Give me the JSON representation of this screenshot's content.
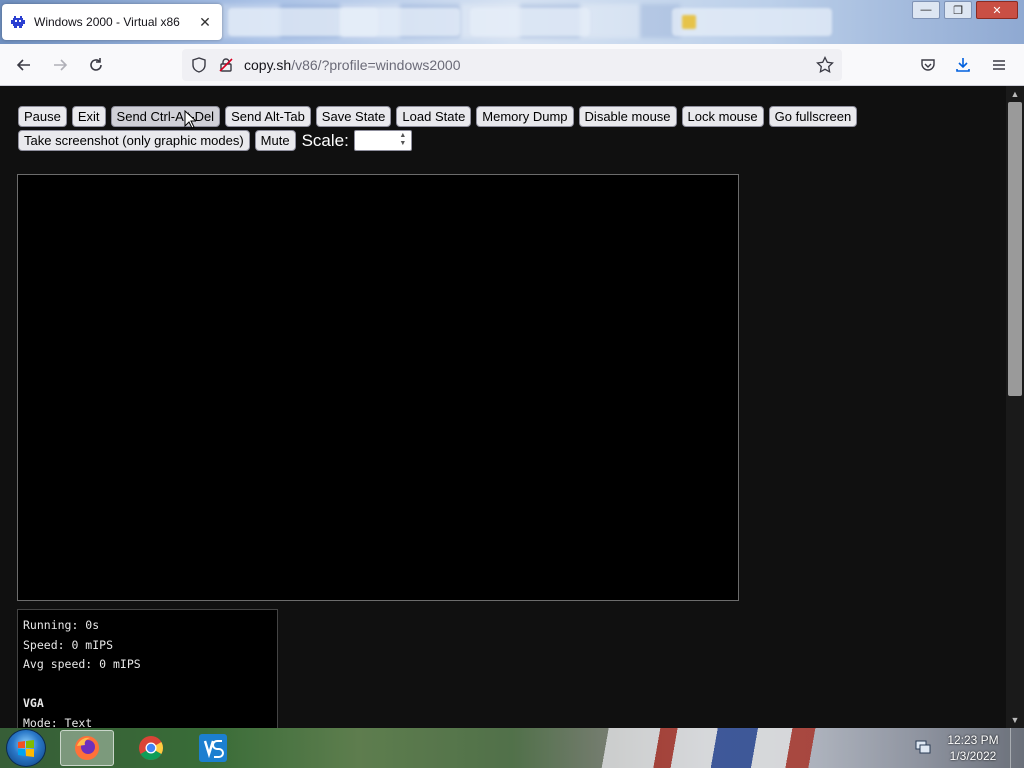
{
  "browser": {
    "tab_title": "Windows 2000 - Virtual x86",
    "tab_close": "✕",
    "background_tabs": [
      "",
      "",
      "",
      ""
    ],
    "url_domain": "copy.sh",
    "url_path": "/v86/?profile=windows2000",
    "window_controls": {
      "minimize": "—",
      "restore": "❐",
      "close": "✕"
    }
  },
  "toolbar": {
    "row1": [
      "Pause",
      "Exit",
      "Send Ctrl-Alt-Del",
      "Send Alt-Tab",
      "Save State",
      "Load State",
      "Memory Dump",
      "Disable mouse",
      "Lock mouse",
      "Go fullscreen"
    ],
    "row2": [
      "Take screenshot (only graphic modes)",
      "Mute"
    ],
    "scale_label": "Scale:",
    "scale_value": ""
  },
  "stats": {
    "running": "Running: 0s",
    "speed": "Speed: 0 mIPS",
    "avg_speed": "Avg speed: 0 mIPS",
    "vga_heading": "VGA",
    "mode": "Mode: Text"
  },
  "taskbar": {
    "apps": [
      "firefox-icon",
      "chrome-icon",
      "vmware-icon"
    ],
    "time": "12:23 PM",
    "date": "1/3/2022"
  },
  "colors": {
    "page_bg": "#101010",
    "button_bg": "#e9e9ed",
    "screen_bg": "#000000",
    "stats_text": "#e8e8e8"
  }
}
